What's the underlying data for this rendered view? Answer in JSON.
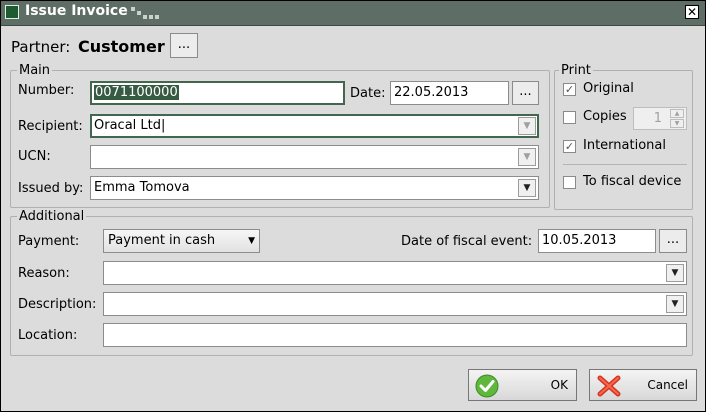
{
  "window": {
    "title": "Issue Invoice",
    "close_symbol": "✕"
  },
  "partner": {
    "label": "Partner:",
    "value": "Customer",
    "browse_label": "..."
  },
  "main": {
    "group_title": "Main",
    "number_label": "Number:",
    "number_value": "0071100000",
    "date_label": "Date:",
    "date_value": "22.05.2013",
    "date_button": "...",
    "recipient_label": "Recipient:",
    "recipient_value": "Oracal Ltd",
    "ucn_label": "UCN:",
    "ucn_value": "",
    "issued_by_label": "Issued by:",
    "issued_by_value": "Emma Tomova"
  },
  "print": {
    "group_title": "Print",
    "original_label": "Original",
    "original_checked": true,
    "copies_label": "Copies",
    "copies_checked": false,
    "copies_value": "1",
    "international_label": "International",
    "international_checked": true,
    "fiscal_label": "To fiscal device",
    "fiscal_checked": false
  },
  "additional": {
    "group_title": "Additional",
    "payment_label": "Payment:",
    "payment_value": "Payment in cash",
    "fiscal_event_label": "Date of fiscal event:",
    "fiscal_event_value": "10.05.2013",
    "fiscal_event_button": "...",
    "reason_label": "Reason:",
    "reason_value": "",
    "description_label": "Description:",
    "description_value": "",
    "location_label": "Location:",
    "location_value": ""
  },
  "buttons": {
    "ok": "OK",
    "cancel": "Cancel"
  },
  "icons": {
    "ok": "check-icon",
    "cancel": "cross-icon",
    "dropdown": "chevron-down-icon"
  },
  "colors": {
    "titlebar": "#5e6d65",
    "selection": "#375a43",
    "ok_green": "#5fb83b",
    "cancel_red": "#d8331f"
  }
}
